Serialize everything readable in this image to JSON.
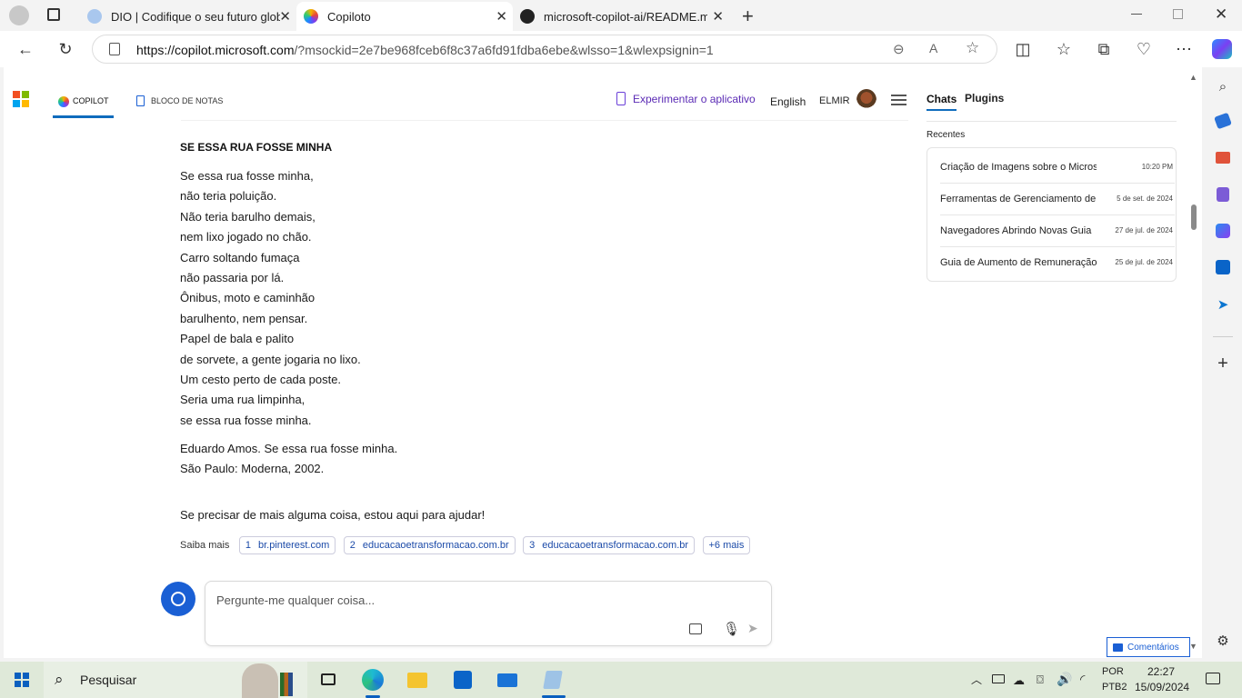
{
  "browser": {
    "tabs": [
      {
        "title": "DIO | Codifique o seu futuro glob",
        "active": false
      },
      {
        "title": "Copiloto",
        "active": true
      },
      {
        "title": "microsoft-copilot-ai/README.md",
        "active": false
      }
    ],
    "url_host": "https://copilot.microsoft.com",
    "url_rest": "/?msockid=2e7be968fceb6f8c37a6fd91fdba6ebe&wlsso=1&wlexpsignin=1"
  },
  "header": {
    "copilot_tab": "COPILOT",
    "notebook_tab": "BLOCO DE NOTAS",
    "try_app": "Experimentar o aplicativo",
    "language": "English",
    "user": "ELMIR"
  },
  "poem": {
    "title": "SE ESSA RUA FOSSE MINHA",
    "lines": [
      "Se essa rua fosse minha,",
      "não teria poluição.",
      "Não teria barulho demais,",
      "nem lixo jogado no chão.",
      "Carro soltando fumaça",
      "não passaria por lá.",
      "Ônibus, moto e caminhão",
      "barulhento, nem pensar.",
      "Papel de bala e palito",
      "de sorvete, a gente jogaria no lixo.",
      "Um cesto perto de cada poste.",
      "Seria uma rua limpinha,",
      "se essa rua fosse minha."
    ],
    "citation": [
      "Eduardo Amos. Se essa rua fosse minha.",
      "São Paulo: Moderna, 2002."
    ],
    "closing": "Se precisar de mais alguma coisa, estou aqui para ajudar!"
  },
  "learn_more": {
    "label": "Saiba mais",
    "sources": [
      {
        "num": "1",
        "site": "br.pinterest.com"
      },
      {
        "num": "2",
        "site": "educacaoetransformacao.com.br"
      },
      {
        "num": "3",
        "site": "educacaoetransformacao.com.br"
      }
    ],
    "more": "+6 mais"
  },
  "composer": {
    "placeholder": "Pergunte-me qualquer coisa..."
  },
  "sidebar": {
    "tab_chats": "Chats",
    "tab_plugins": "Plugins",
    "recent_label": "Recentes",
    "chats": [
      {
        "title": "Criação de Imagens sobre o Microsoft C",
        "date": "10:20 PM"
      },
      {
        "title": "Ferramentas de Gerenciamento de",
        "date": "5 de set. de 2024"
      },
      {
        "title": "Navegadores Abrindo Novas Guia",
        "date": "27 de jul. de 2024"
      },
      {
        "title": "Guia de Aumento de Remuneração",
        "date": "25 de jul. de 2024"
      }
    ],
    "feedback": "Comentários"
  },
  "taskbar": {
    "search": "Pesquisar",
    "lang_top": "POR",
    "lang_bottom": "PTB2",
    "time": "22:27",
    "date": "15/09/2024"
  },
  "colors": {
    "accent": "#0f6cbd",
    "link": "#1b4aa8",
    "copilot_purple": "#6a3fd8"
  }
}
